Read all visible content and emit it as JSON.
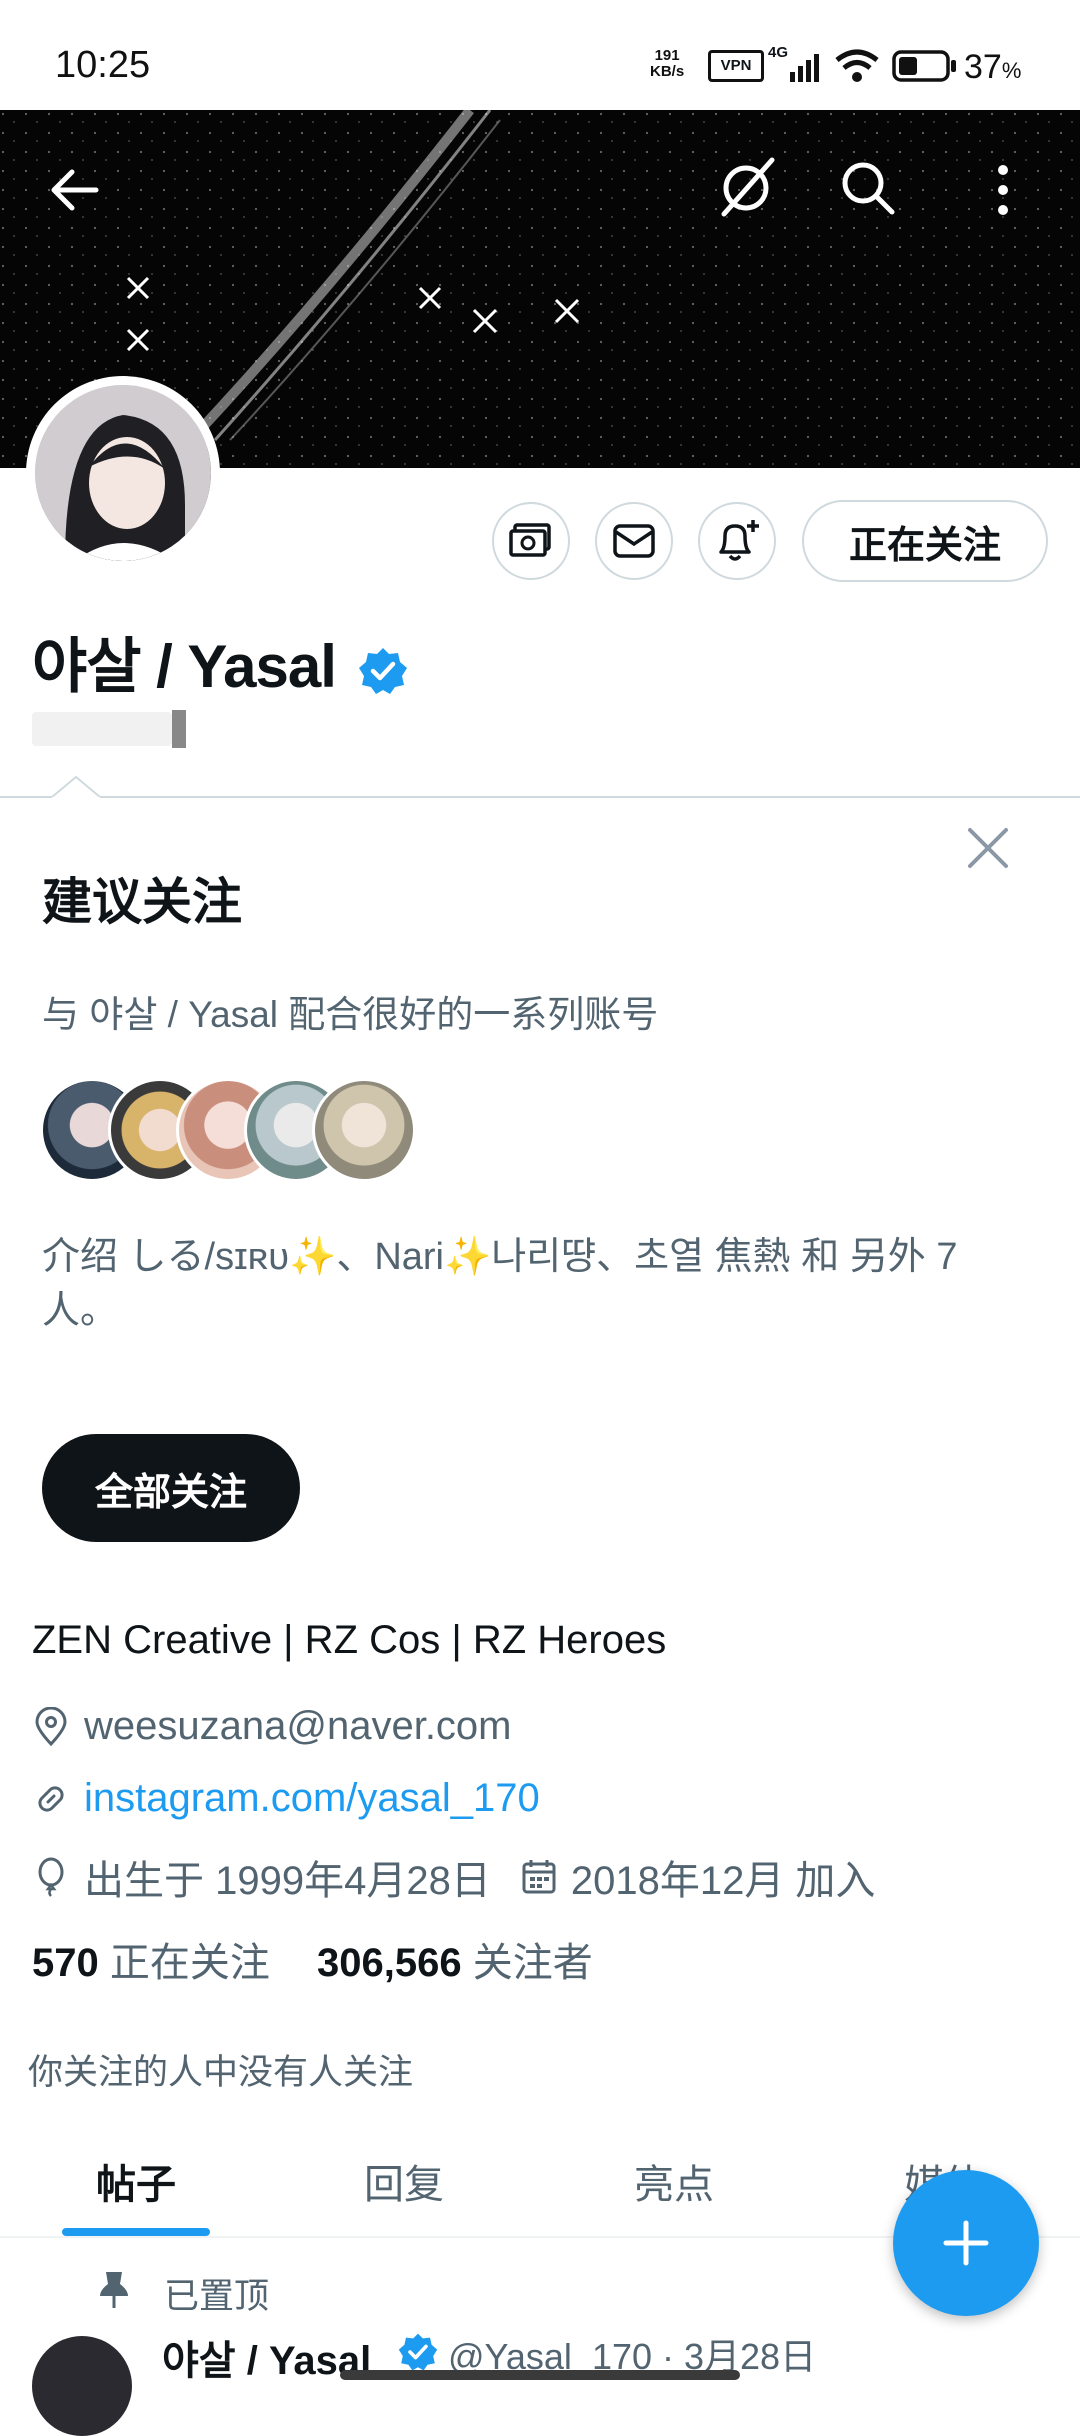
{
  "status_bar": {
    "time": "10:25",
    "net_speed_value": "191",
    "net_speed_unit": "KB/s",
    "vpn": "VPN",
    "network": "4G",
    "battery": "37",
    "battery_unit": "%"
  },
  "profile": {
    "display_name": "야살 / Yasal",
    "following_button": "正在关注",
    "bio": "ZEN Creative | RZ Cos | RZ Heroes",
    "email": "weesuzana@naver.com",
    "website": "instagram.com/yasal_170",
    "birthday": "出生于 1999年4月28日",
    "joined": "2018年12月 加入",
    "following_count": "570",
    "following_label": "正在关注",
    "followers_count": "306,566",
    "followers_label": "关注者",
    "followed_by": "你关注的人中没有人关注"
  },
  "suggested": {
    "title": "建议关注",
    "description": "与 야살 / Yasal 配合很好的一系列账号",
    "intro": "介绍 しる/sɪʀᴜ✨、Nari✨나리땽、초열 焦熱 和 另外 7 人。",
    "follow_all": "全部关注"
  },
  "tabs": [
    "帖子",
    "回复",
    "亮点",
    "媒体"
  ],
  "post": {
    "pinned": "已置顶",
    "author": "야살 / Yasal",
    "handle_date": "@Yasal_170 · 3月28日"
  },
  "icons": [
    "back-icon",
    "grok-icon",
    "search-icon",
    "more-icon",
    "money-icon",
    "mail-icon",
    "bell-plus-icon",
    "verified-icon",
    "close-icon",
    "location-icon",
    "link-icon",
    "balloon-icon",
    "calendar-icon",
    "pin-icon",
    "plus-icon"
  ],
  "colors": {
    "accent": "#1d9bf0",
    "text": "#0f1419",
    "secondary": "#536471",
    "banner": "#050505"
  }
}
